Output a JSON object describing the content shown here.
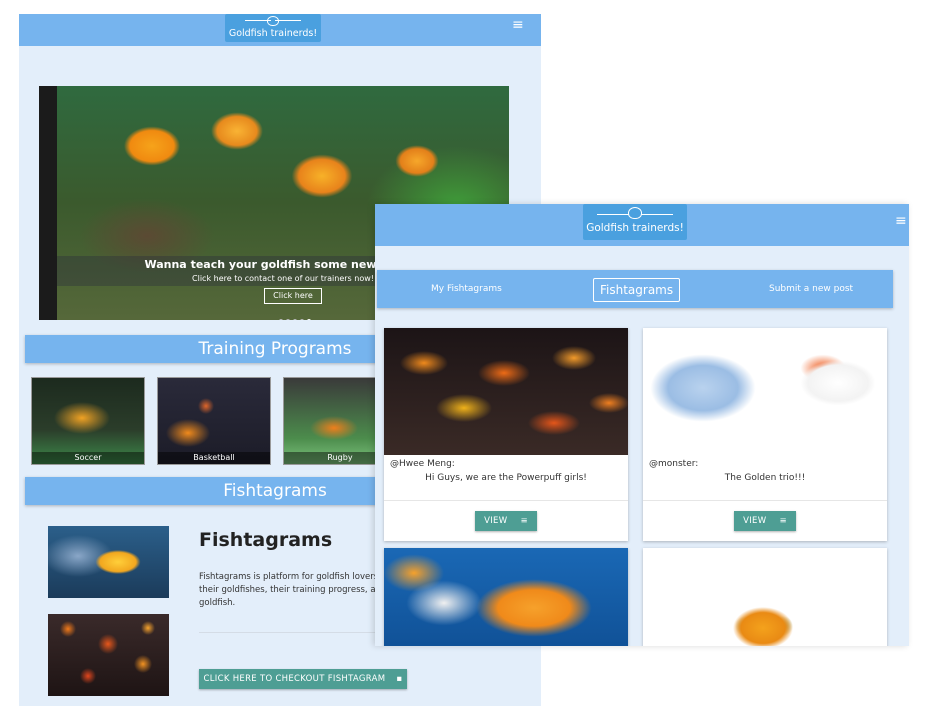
{
  "brand": {
    "name": "Goldfish trainerds!"
  },
  "home": {
    "hero": {
      "headline": "Wanna teach your goldfish some new tricks?",
      "subline": "Click here to contact one of our trainers now!",
      "button": "Click here"
    },
    "training": {
      "title": "Training Programs",
      "programs": [
        {
          "label": "Soccer"
        },
        {
          "label": "Basketball"
        },
        {
          "label": "Rugby"
        }
      ]
    },
    "fishtagrams": {
      "section_title": "Fishtagrams",
      "heading": "Fishtagrams",
      "description": "Fishtagrams is platform for goldfish lovers to share the pictures of their goldfishes, their training progress, any share their love for their goldfish.",
      "cta": "CLICK HERE TO CHECKOUT FISHTAGRAM"
    }
  },
  "feed": {
    "tabs": [
      {
        "label": "My Fishtagrams"
      },
      {
        "label": "Fishtagrams"
      },
      {
        "label": "Submit a new post"
      }
    ],
    "active_tab": "Fishtagrams",
    "posts": [
      {
        "author": "@Hwee Meng:",
        "caption": "Hi Guys, we are the Powerpuff girls!",
        "button": "VIEW"
      },
      {
        "author": "@monster:",
        "caption": "The Golden trio!!!",
        "button": "VIEW"
      }
    ]
  },
  "colors": {
    "navbar": "#76b4ee",
    "logo_bg": "#4aa0df",
    "page_bg": "#e3eefa",
    "teal_button": "#4e9e94"
  },
  "icons": {
    "menu": "hamburger-icon",
    "logo": "fishbowl-icon",
    "view": "list-icon",
    "cta": "comment-icon"
  }
}
